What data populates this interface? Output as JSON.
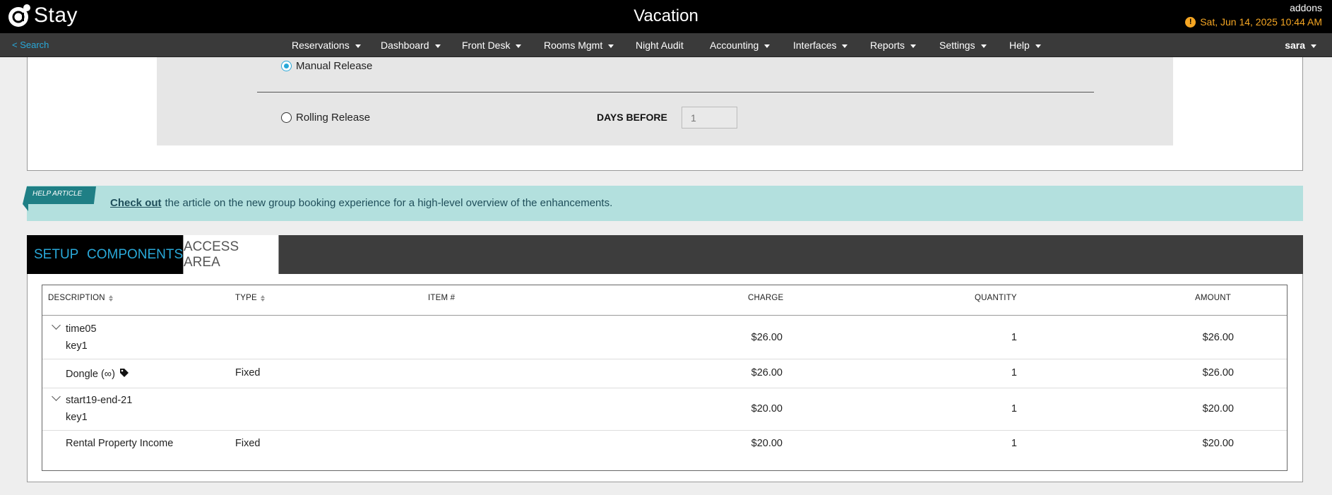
{
  "header": {
    "logo_text": "Stay",
    "app_title": "Vacation",
    "account": "addons",
    "datetime": "Sat, Jun 14, 2025 10:44 AM"
  },
  "nav": {
    "search": "< Search",
    "items": [
      "Reservations",
      "Dashboard",
      "Front Desk",
      "Rooms Mgmt",
      "Night Audit",
      "Accounting",
      "Interfaces",
      "Reports",
      "Settings",
      "Help"
    ],
    "user": "sara"
  },
  "release": {
    "manual_label": "Manual Release",
    "manual_selected": true,
    "rolling_label": "Rolling Release",
    "days_before_label": "DAYS BEFORE",
    "days_before_placeholder": "1"
  },
  "help": {
    "ribbon": "HELP ARTICLE",
    "link": "Check out",
    "text": "the article on the new group booking experience for a high-level overview of the enhancements."
  },
  "tabs": {
    "setup": "SETUP",
    "components": "COMPONENTS",
    "access_area": "ACCESS AREA",
    "active": "ACCESS AREA"
  },
  "table": {
    "headers": {
      "description": "DESCRIPTION",
      "type": "TYPE",
      "item": "ITEM #",
      "charge": "CHARGE",
      "quantity": "QUANTITY",
      "amount": "AMOUNT"
    },
    "rows": [
      {
        "name": "time05",
        "sub": "key1",
        "type": "",
        "charge": "$26.00",
        "quantity": "1",
        "amount": "$26.00"
      },
      {
        "name": "Dongle (∞)",
        "type": "Fixed",
        "charge": "$26.00",
        "quantity": "1",
        "amount": "$26.00"
      },
      {
        "name": "start19-end-21",
        "sub": "key1",
        "type": "",
        "charge": "$20.00",
        "quantity": "1",
        "amount": "$20.00"
      },
      {
        "name": "Rental Property Income",
        "type": "Fixed",
        "charge": "$20.00",
        "quantity": "1",
        "amount": "$20.00"
      }
    ]
  },
  "colors": {
    "accent": "#29a8d8",
    "warning": "#f5a623",
    "help_bg": "#b3e0de",
    "ribbon": "#1f7f85"
  }
}
